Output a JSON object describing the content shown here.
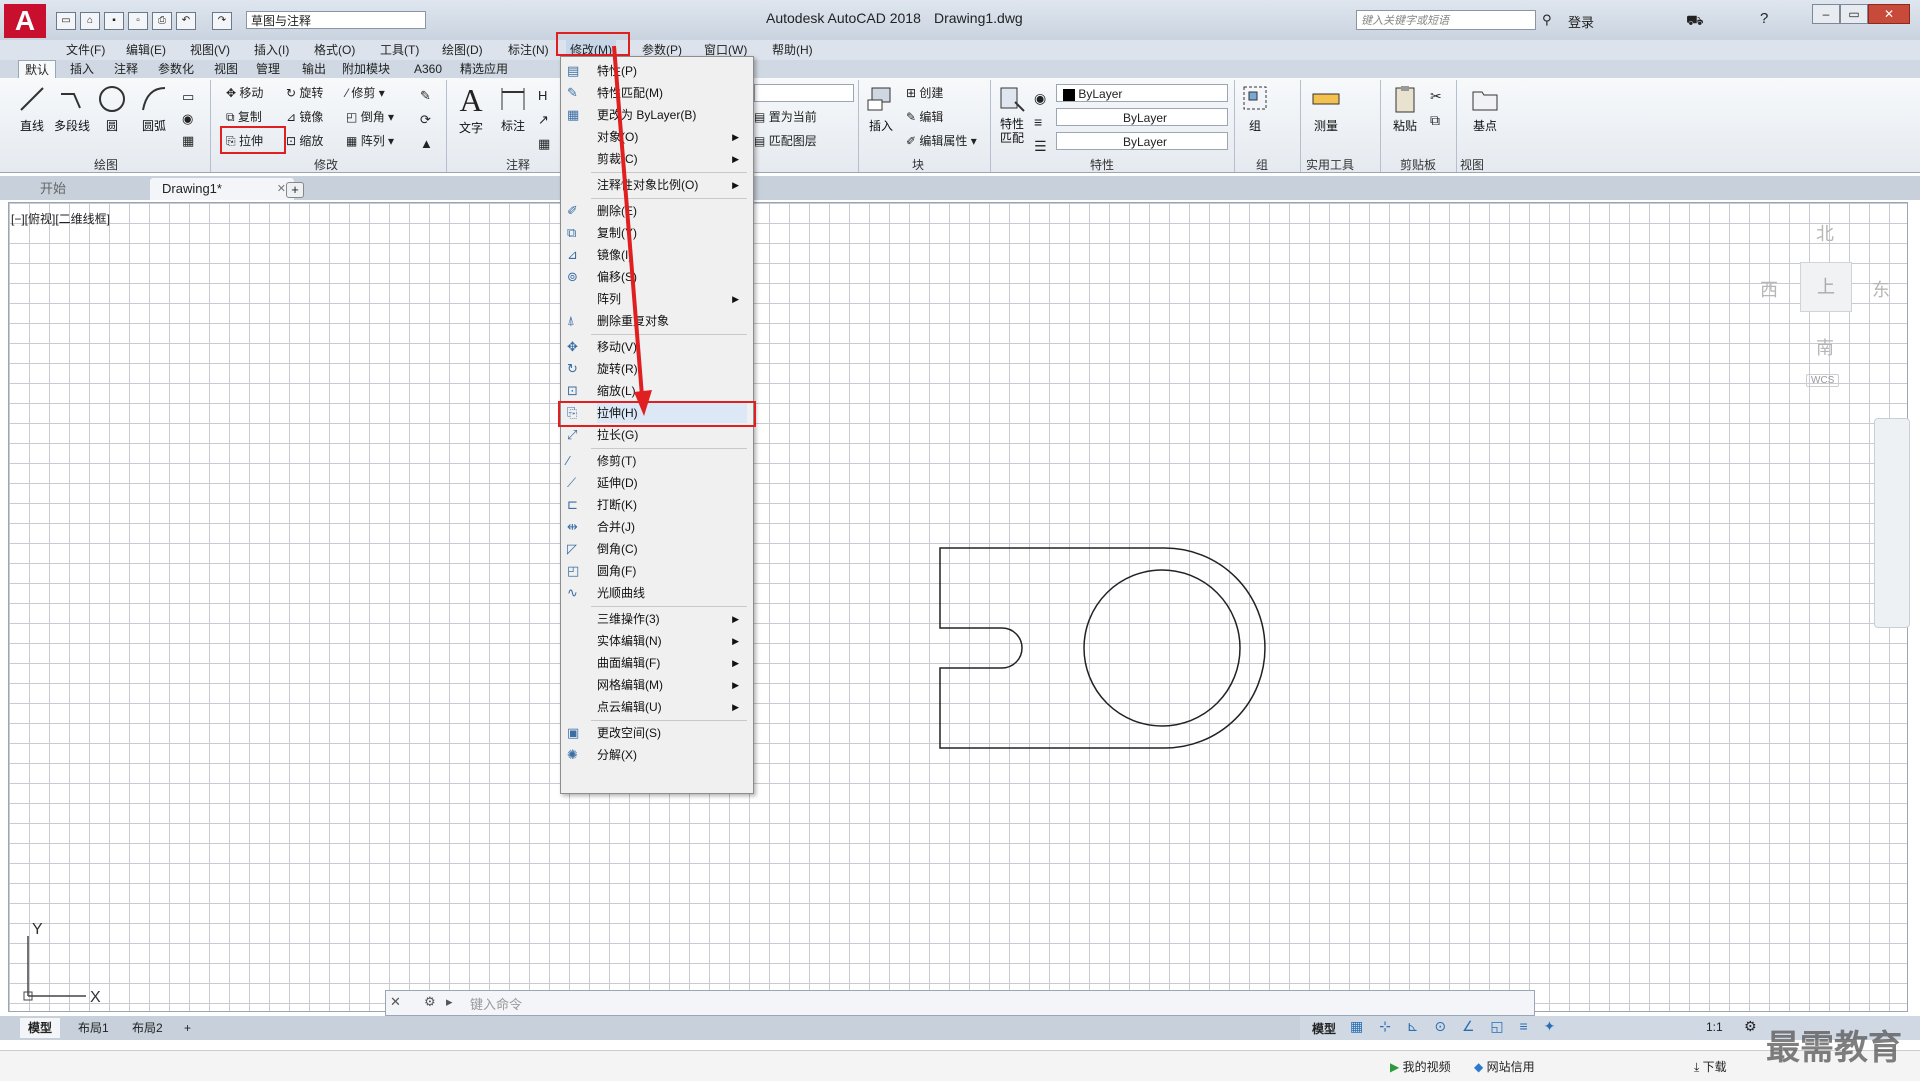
{
  "app": {
    "title": "Autodesk AutoCAD 2018",
    "file": "Drawing1.dwg",
    "workspace": "草图与注释",
    "search_placeholder": "键入关键字或短语",
    "login": "登录",
    "logo": "A"
  },
  "menubar": [
    "文件(F)",
    "编辑(E)",
    "视图(V)",
    "插入(I)",
    "格式(O)",
    "工具(T)",
    "绘图(D)",
    "标注(N)",
    "修改(M)",
    "参数(P)",
    "窗口(W)",
    "帮助(H)"
  ],
  "ribbon_tabs": [
    "默认",
    "插入",
    "注释",
    "参数化",
    "视图",
    "管理",
    "输出",
    "附加模块",
    "A360",
    "精选应用"
  ],
  "ribbon": {
    "draw": {
      "line": "直线",
      "polyline": "多段线",
      "circle": "圆",
      "arc": "圆弧",
      "label": "绘图"
    },
    "modify": {
      "move": "移动",
      "rotate": "旋转",
      "trim": "修剪",
      "copy": "复制",
      "mirror": "镜像",
      "fillet": "倒角",
      "stretch": "拉伸",
      "scale": "缩放",
      "array": "阵列",
      "label": "修改"
    },
    "annotation": {
      "text": "文字",
      "dim": "标注",
      "label": "注释"
    },
    "layers": {
      "current": "置为当前",
      "match": "匹配图层"
    },
    "block": {
      "insert": "插入",
      "create": "创建",
      "edit": "编辑",
      "edit_attr": "编辑属性",
      "label": "块"
    },
    "properties": {
      "match": "特性匹配",
      "color": "ByLayer",
      "linetype": "ByLayer",
      "lineweight": "ByLayer",
      "label": "特性"
    },
    "groups": {
      "group": "组",
      "label": "组"
    },
    "utilities": {
      "measure": "测量",
      "label": "实用工具"
    },
    "clipboard": {
      "paste": "粘贴",
      "label": "剪贴板"
    },
    "view": {
      "base": "基点",
      "label": "视图"
    }
  },
  "doc_tabs": [
    "开始",
    "Drawing1*"
  ],
  "viewport_label": "[−][俯视][二维线框]",
  "viewcube": {
    "north": "北",
    "south": "南",
    "east": "东",
    "west": "西",
    "top": "上",
    "wcs": "WCS"
  },
  "context_menu": {
    "items": [
      {
        "label": "特性(P)",
        "icon": "properties-icon"
      },
      {
        "label": "特性匹配(M)",
        "icon": "match-properties-icon"
      },
      {
        "label": "更改为 ByLayer(B)",
        "icon": "bylayer-icon"
      },
      {
        "label": "对象(O)",
        "submenu": true
      },
      {
        "label": "剪裁(C)",
        "submenu": true
      },
      {
        "label": "注释性对象比例(O)",
        "submenu": true
      },
      {
        "label": "删除(E)",
        "icon": "erase-icon"
      },
      {
        "label": "复制(Y)",
        "icon": "copy-icon"
      },
      {
        "label": "镜像(I)",
        "icon": "mirror-icon"
      },
      {
        "label": "偏移(S)",
        "icon": "offset-icon"
      },
      {
        "label": "阵列",
        "submenu": true
      },
      {
        "label": "删除重复对象",
        "icon": "delete-duplicates-icon"
      },
      {
        "label": "移动(V)",
        "icon": "move-icon"
      },
      {
        "label": "旋转(R)",
        "icon": "rotate-icon"
      },
      {
        "label": "缩放(L)",
        "icon": "scale-icon"
      },
      {
        "label": "拉伸(H)",
        "icon": "stretch-icon",
        "highlighted": true
      },
      {
        "label": "拉长(G)",
        "icon": "lengthen-icon"
      },
      {
        "label": "修剪(T)",
        "icon": "trim-icon"
      },
      {
        "label": "延伸(D)",
        "icon": "extend-icon"
      },
      {
        "label": "打断(K)",
        "icon": "break-icon"
      },
      {
        "label": "合并(J)",
        "icon": "join-icon"
      },
      {
        "label": "倒角(C)",
        "icon": "chamfer-icon"
      },
      {
        "label": "圆角(F)",
        "icon": "fillet-icon"
      },
      {
        "label": "光顺曲线",
        "icon": "blend-icon"
      },
      {
        "label": "三维操作(3)",
        "submenu": true
      },
      {
        "label": "实体编辑(N)",
        "submenu": true
      },
      {
        "label": "曲面编辑(F)",
        "submenu": true
      },
      {
        "label": "网格编辑(M)",
        "submenu": true
      },
      {
        "label": "点云编辑(U)",
        "submenu": true
      },
      {
        "label": "更改空间(S)",
        "icon": "change-space-icon"
      },
      {
        "label": "分解(X)",
        "icon": "explode-icon"
      }
    ]
  },
  "command_line": {
    "placeholder": "键入命令"
  },
  "layout_tabs": [
    "模型",
    "布局1",
    "布局2"
  ],
  "status": {
    "model": "模型",
    "scale": "1:1"
  },
  "taskbar": {
    "video": "我的视频",
    "net": "网站信用",
    "download": "下载"
  },
  "watermark": "最需教育",
  "colors": {
    "accent_red": "#e02020",
    "title_bg": "#dfe6ef"
  }
}
